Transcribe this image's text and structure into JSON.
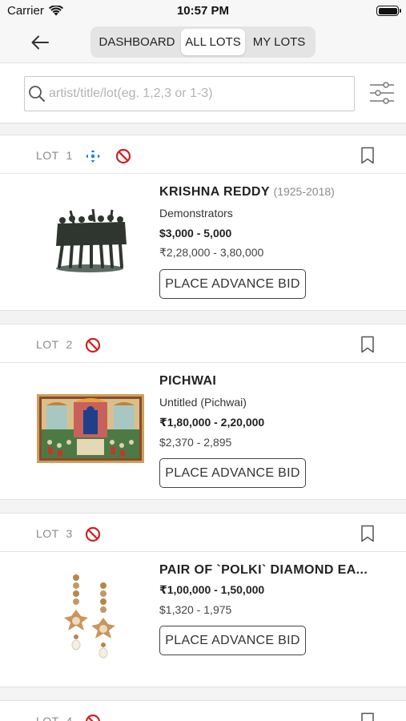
{
  "status_bar": {
    "carrier": "Carrier",
    "time": "10:57 PM"
  },
  "nav": {
    "tabs": [
      {
        "label": "DASHBOARD",
        "active": false
      },
      {
        "label": "ALL LOTS",
        "active": true
      },
      {
        "label": "MY LOTS",
        "active": false
      }
    ]
  },
  "search": {
    "placeholder": "artist/title/lot(eg. 1,2,3 or 1-3)",
    "value": ""
  },
  "lots": [
    {
      "lot_label": "LOT",
      "lot_number": "1",
      "artist": "KRISHNA REDDY",
      "years": "(1925-2018)",
      "title": "Demonstrators",
      "price_primary": "$3,000 - 5,000",
      "price_secondary": "₹2,28,000 - 3,80,000",
      "bid_label": "PLACE ADVANCE BID"
    },
    {
      "lot_label": "LOT",
      "lot_number": "2",
      "artist": "PICHWAI",
      "years": "",
      "title": "Untitled (Pichwai)",
      "price_primary": "₹1,80,000 - 2,20,000",
      "price_secondary": "$2,370 - 2,895",
      "bid_label": "PLACE ADVANCE BID"
    },
    {
      "lot_label": "LOT",
      "lot_number": "3",
      "artist": "PAIR OF `POLKI` DIAMOND EA...",
      "years": "",
      "title": "",
      "price_primary": "₹1,00,000 - 1,50,000",
      "price_secondary": "$1,320 - 1,975",
      "bid_label": "PLACE ADVANCE BID"
    },
    {
      "lot_label": "LOT",
      "lot_number": "4"
    }
  ],
  "colors": {
    "accent_blue": "#1e7fd0",
    "restricted_red": "#d32020"
  }
}
